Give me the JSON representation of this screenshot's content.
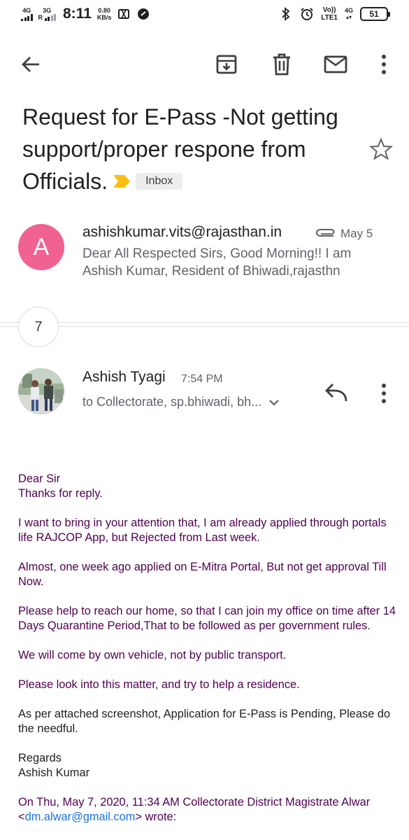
{
  "status_bar": {
    "net1": "4G",
    "net2": "3G",
    "net2_sub": "R",
    "time": "8:11",
    "speed_value": "0.80",
    "speed_unit": "KB/s",
    "volte_top": "Vo))",
    "volte_bottom": "LTE1",
    "net3": "4G",
    "battery": "51"
  },
  "toolbar": {
    "back_icon": "arrow-back-icon",
    "archive_icon": "archive-icon",
    "delete_icon": "delete-icon",
    "mail_icon": "mark-unread-icon",
    "more_icon": "more-vert-icon"
  },
  "subject": {
    "text": "Request for E-Pass -Not getting support/proper respone from Officials.",
    "label": "Inbox",
    "important_color": "#f9bd11"
  },
  "collapsed_message": {
    "avatar_letter": "A",
    "avatar_color": "#f06292",
    "sender": "ashishkumar.vits@rajasthan.in",
    "date": "May 5",
    "snippet": "Dear All Respected Sirs, Good Morning!! I am Ashish Kumar, Resident of Bhiwadi,rajasthn"
  },
  "thread_counter": "7",
  "expanded_message": {
    "sender": "Ashish Tyagi",
    "time": "7:54 PM",
    "recipients": "to Collectorate, sp.bhiwadi, bh..."
  },
  "body": {
    "p1_line1": "Dear Sir",
    "p1_line2": "Thanks for reply.",
    "p2": "I want to bring in your attention that, I am already applied through portals life RAJCOP App, but Rejected from Last week.",
    "p3": "Almost, one week ago applied on E-Mitra Portal, But not get approval Till Now.",
    "p4": "Please help to reach our home, so that I can join my office on time after 14 Days Quarantine Period,That to be followed as per government rules.",
    "p5": "We will come by own vehicle, not by public transport.",
    "p6": "Please look into this matter, and try to help a residence.",
    "p7": "As per attached screenshot, Application for E-Pass is Pending, Please do the needful.",
    "p8_line1": "Regards",
    "p8_line2": "Ashish Kumar",
    "quote_prefix": "On Thu, May 7, 2020, 11:34 AM Collectorate District Magistrate Alwar <",
    "quote_email": "dm.alwar@gmail.com",
    "quote_suffix": "> wrote:"
  },
  "colors": {
    "quoted_text": "#500050",
    "link": "#1a73e8"
  }
}
